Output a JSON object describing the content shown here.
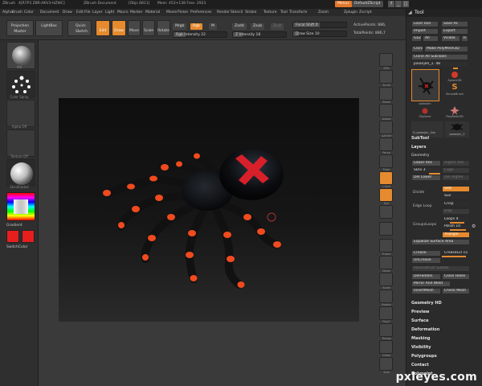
{
  "titlebar": {
    "app": "ZBrush",
    "info1": "4[R7P3 ZBR-AKV3-HZWC]",
    "info2": "ZBrush Document",
    "info3": "[Objs 6811]",
    "info4": "Mem: 453+138 Free: 2923",
    "menus_label": "Menus",
    "script_label": "DefaultZScript"
  },
  "menubar": [
    "Alpha",
    "Brush",
    "Color",
    "Document",
    "Draw",
    "Edit",
    "File",
    "Layer",
    "Light",
    "Macro",
    "Marker",
    "Material",
    "Movie",
    "Picker",
    "Preferences",
    "Render",
    "Stencil",
    "Stroke",
    "Texture",
    "Tool",
    "Transform",
    "Zoom",
    "Zplugin",
    "Zscript"
  ],
  "shelf": {
    "projection_master": "Projection Master",
    "lightbox": "LightBox",
    "quick_sketch": "Quick Sketch",
    "edit": "Edit",
    "draw": "Draw",
    "move": "Move",
    "scale": "Scale",
    "rotate": "Rotate",
    "mrgb": "Mrgb",
    "rgb": "Rgb",
    "m": "M",
    "rgb_intensity": "Rgb Intensity 22",
    "zadd": "Zadd",
    "zsub": "Zsub",
    "zcut": "Zcut",
    "z_intensity": "Z Intensity 18",
    "focal_shift": "Focal Shift 0",
    "draw_size": "Draw Size 10",
    "active_points": "ActivePoints: 886,",
    "total_points": "TotalPoints: 886,7"
  },
  "left_tray": {
    "brush": "Std",
    "stroke": "Color Spray",
    "alpha": "Alpha Off",
    "texture": "Texture Off",
    "material": "SkinShade4",
    "gradient": "Gradient",
    "switch_color": "SwitchColor"
  },
  "right_bar": [
    "SPix",
    "Scroll",
    "Zoom",
    "Actual",
    "AAHalf",
    "Persp",
    "Floor",
    "L.Sym",
    "Xyz",
    "",
    "",
    "Frame",
    "Move",
    "Scale",
    "Rotate",
    "PolyF",
    "Transp",
    "Ghost",
    "Solo"
  ],
  "palette": {
    "title": "Tool",
    "load_tool": "Load Tool",
    "save_as": "Save As",
    "import": "Import",
    "export": "Export",
    "goz": "GoZ",
    "all": "All",
    "visible": "Visible",
    "r": "R",
    "clone": "Clone",
    "make_polymesh": "Make PolyMesh3D",
    "clone_all": "Clone All SubTools",
    "tool_slider": "paianjen_1. 48",
    "thumbs": [
      "paianjen",
      "Sphere3D",
      "SimpleBrush",
      "ZSphere",
      "PolyMesh3D",
      "paianjen_1"
    ],
    "current_tool": "D_paianjen_1ba",
    "subtool": "SubTool",
    "layers": "Layers",
    "geometry": "Geometry",
    "lower_res": "Lower Res",
    "higher_res": "Higher Res",
    "sdiv": "SDiv 3",
    "cage": "Cage",
    "del_lower": "Del Lower",
    "del_higher": "Del Higher",
    "divide": "Divide",
    "smt": "Smt",
    "suv": "Suv",
    "edge_loop": "Edge Loop",
    "crisp": "Crisp",
    "disp": "Disp",
    "groups_loops": "GroupsLoops",
    "loops": "Loops 4",
    "polish": "Polish 10",
    "triangle": "Triangle",
    "equalize": "Equalize Surface Area",
    "crease": "Crease",
    "crease_lvl": "CreaseLvl 15",
    "uncrease": "UnCrease",
    "reconstruct": "Reconstruct Subdiv",
    "delhidden": "DelHidden",
    "close_holes": "Close Holes",
    "mirror_weld": "Mirror And Weld",
    "insert_mesh": "InsertMesh",
    "check_mesh": "Check Mesh",
    "geometry_hd": "Geometry HD",
    "preview": "Preview",
    "surface": "Surface",
    "deformation": "Deformation",
    "masking": "Masking",
    "visibility": "Visibility",
    "polygroups": "Polygroups",
    "contact": "Contact",
    "polypaint": "Polypaint"
  },
  "watermark": "pxleyes.com",
  "colors": {
    "accent": "#e58a2e",
    "spider_body": "#0c0c0e",
    "spider_spots": "#f04a1f",
    "cross": "#d8202a"
  }
}
